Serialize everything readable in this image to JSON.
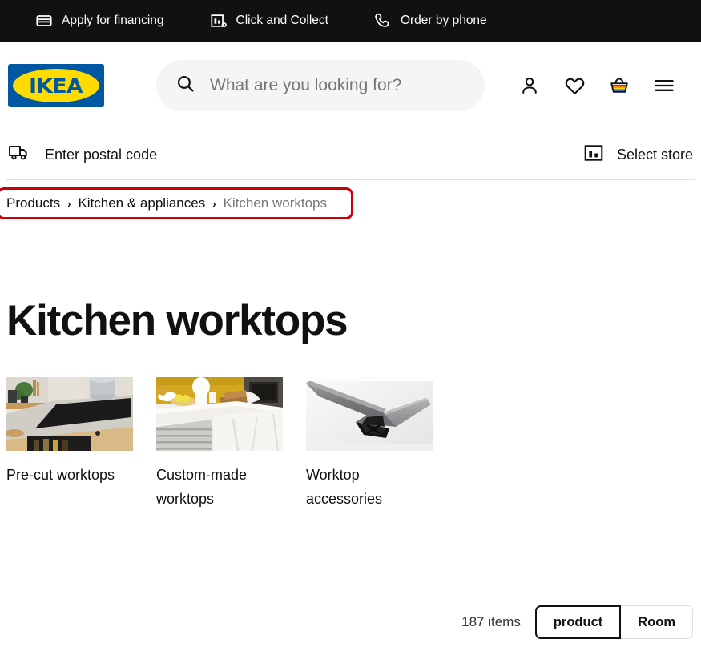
{
  "topbar": {
    "items": [
      {
        "label": "Apply for financing",
        "icon": "credit-card-icon"
      },
      {
        "label": "Click and Collect",
        "icon": "store-pickup-icon"
      },
      {
        "label": "Order by phone",
        "icon": "phone-icon"
      }
    ]
  },
  "header": {
    "logo_text": "IKEA",
    "logo_registered": "®",
    "logo_bg": "#0058a3",
    "logo_fg": "#ffdb00",
    "search": {
      "placeholder": "What are you looking for?",
      "value": ""
    },
    "icons": [
      {
        "name": "account-icon",
        "label": "Account"
      },
      {
        "name": "favourites-heart-icon",
        "label": "Favourites"
      },
      {
        "name": "shopping-bag-icon",
        "label": "Shopping bag"
      },
      {
        "name": "menu-hamburger-icon",
        "label": "Menu"
      }
    ]
  },
  "locationbar": {
    "postal": {
      "label": "Enter postal code",
      "icon": "delivery-truck-icon"
    },
    "store": {
      "label": "Select store",
      "icon": "store-icon"
    }
  },
  "breadcrumb": {
    "highlight_color": "#cc0008",
    "separator": "›",
    "items": [
      {
        "label": "Products",
        "current": false
      },
      {
        "label": "Kitchen & appliances",
        "current": false
      },
      {
        "label": "Kitchen worktops",
        "current": true
      }
    ]
  },
  "main": {
    "title": "Kitchen worktops",
    "categories": [
      {
        "label": "Pre-cut worktops",
        "image": "kitchen-grey-worktop-hob-photo"
      },
      {
        "label": "Custom-made worktops",
        "image": "white-marble-worktop-kitchen-photo"
      },
      {
        "label": "Worktop accessories",
        "image": "grey-worktop-edging-profile-photo"
      }
    ]
  },
  "bottombar": {
    "item_count": "187 items",
    "toggle": {
      "options": [
        {
          "label": "product",
          "selected": true
        },
        {
          "label": "Room",
          "selected": false
        }
      ]
    }
  }
}
